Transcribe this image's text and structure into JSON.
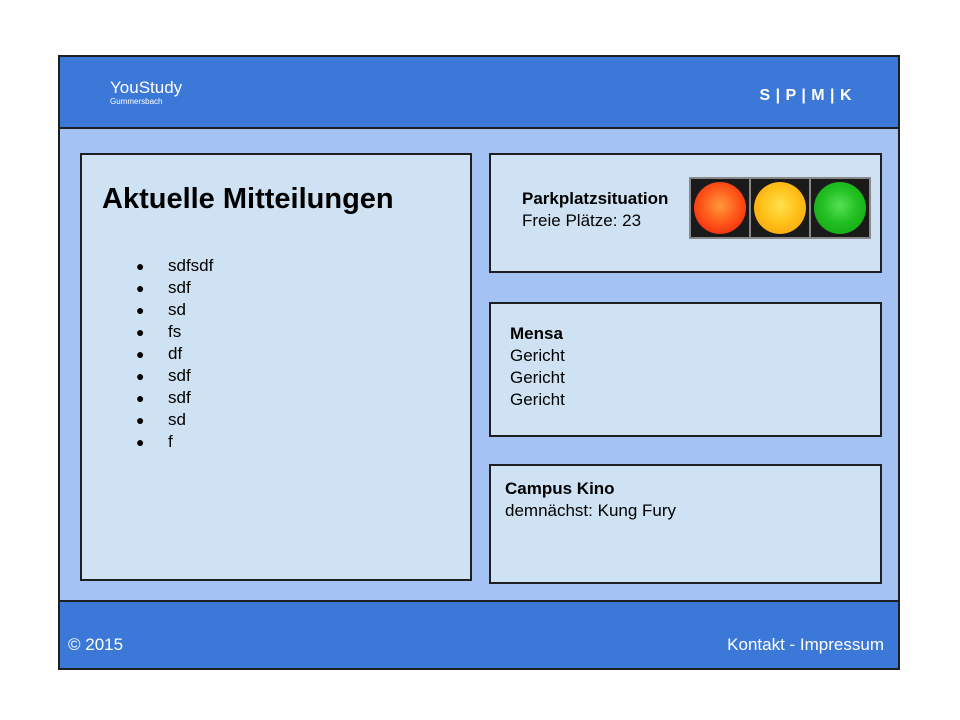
{
  "header": {
    "brand_name": "YouStudy",
    "brand_sub": "Gummersbach",
    "nav_label": "S | P | M | K"
  },
  "news": {
    "title": "Aktuelle Mitteilungen",
    "items": [
      {
        "bullet": "●",
        "text": "sdfsdf"
      },
      {
        "bullet": "●",
        "text": "sdf"
      },
      {
        "bullet": "●",
        "text": "sd"
      },
      {
        "bullet": "●",
        "text": "fs"
      },
      {
        "bullet": "●",
        "text": "df"
      },
      {
        "bullet": "●",
        "text": "sdf"
      },
      {
        "bullet": "●",
        "text": "sdf"
      },
      {
        "bullet": "●",
        "text": "sd"
      },
      {
        "bullet": "●",
        "text": "f"
      }
    ]
  },
  "parking": {
    "title": "Parkplatzsituation",
    "free_label": "Freie Plätze: 23",
    "lights": [
      {
        "name": "red-light-icon",
        "color": "#ff5a1a"
      },
      {
        "name": "yellow-light-icon",
        "color": "#ffc21a"
      },
      {
        "name": "green-light-icon",
        "color": "#22c022"
      }
    ]
  },
  "mensa": {
    "title": "Mensa",
    "dishes": [
      "Gericht",
      "Gericht",
      "Gericht"
    ]
  },
  "kino": {
    "title": "Campus Kino",
    "text": "demnächst: Kung Fury"
  },
  "footer": {
    "copyright": "© 2015",
    "kontakt": "Kontakt",
    "separator": " - ",
    "impressum": "Impressum"
  },
  "colors": {
    "header_bg": "#3c78d8",
    "page_bg": "#a4c2f4",
    "panel_bg": "#cfe2f3"
  }
}
